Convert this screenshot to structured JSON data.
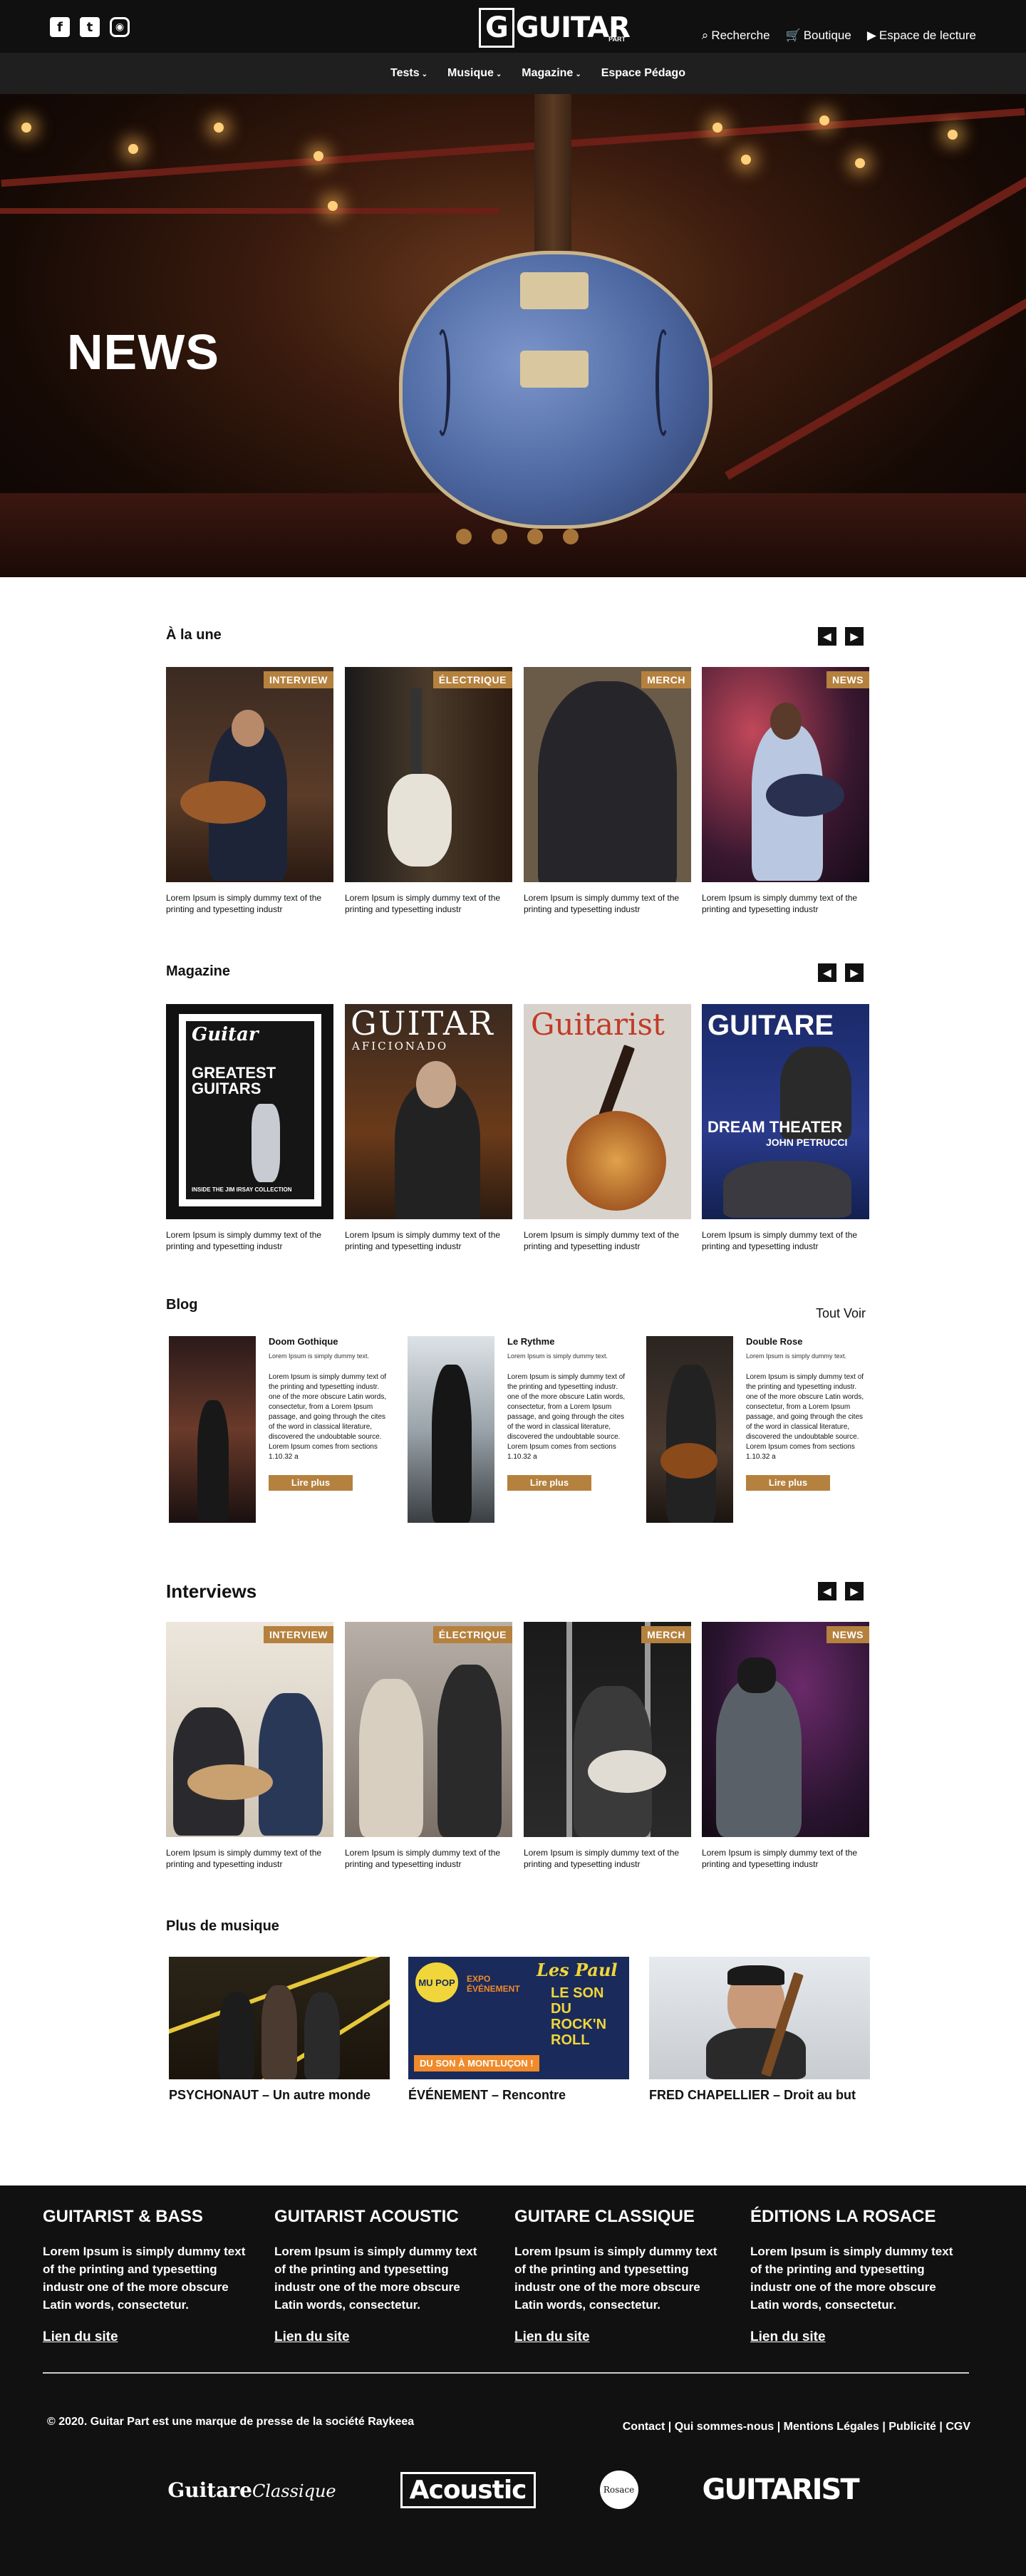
{
  "header": {
    "logo": "GUITAR",
    "logo_sub": "PART",
    "social": [
      "f",
      "t",
      "ig"
    ],
    "tools": {
      "search": "Recherche",
      "shop": "Boutique",
      "reading": "Espace de lecture"
    }
  },
  "nav": [
    "Tests",
    "Musique",
    "Magazine",
    "Espace Pédago"
  ],
  "hero": {
    "title": "NEWS"
  },
  "une": {
    "title": "À la une",
    "cards": [
      {
        "tag": "INTERVIEW",
        "caption": "Lorem Ipsum is simply dummy text of the printing and typesetting industr"
      },
      {
        "tag": "ÉLECTRIQUE",
        "caption": "Lorem Ipsum is simply dummy text of the printing and typesetting industr"
      },
      {
        "tag": "MERCH",
        "caption": "Lorem Ipsum is simply dummy text of the printing and typesetting industr"
      },
      {
        "tag": "NEWS",
        "caption": "Lorem Ipsum is simply dummy text of the printing and typesetting industr"
      }
    ]
  },
  "magazine": {
    "title": "Magazine",
    "covers": [
      {
        "masthead": "Guitar",
        "headline": "GREATEST GUITARS",
        "footer": "INSIDE THE JIM IRSAY COLLECTION",
        "caption": "Lorem Ipsum is simply dummy text of the printing and typesetting industr"
      },
      {
        "masthead": "GUITAR",
        "headline": "AFICIONADO",
        "footer": "",
        "caption": "Lorem Ipsum is simply dummy text of the printing and typesetting industr"
      },
      {
        "masthead": "Guitarist",
        "headline": "",
        "footer": "",
        "caption": "Lorem Ipsum is simply dummy text of the printing and typesetting industr"
      },
      {
        "masthead": "GUITARE",
        "headline": "DREAM THEATER",
        "footer": "JOHN PETRUCCI",
        "caption": "Lorem Ipsum is simply dummy text of the printing and typesetting industr"
      }
    ]
  },
  "blog": {
    "title": "Blog",
    "see_all": "Tout Voir",
    "posts": [
      {
        "title": "Doom Gothique",
        "sub": "Lorem Ipsum is simply dummy text.",
        "body": "Lorem Ipsum is simply dummy text of the printing and typesetting industr. one of the more obscure Latin words, consectetur, from a Lorem Ipsum passage, and going through the cites of the word in classical literature, discovered the undoubtable source. Lorem Ipsum comes from sections 1.10.32 a",
        "button": "Lire plus"
      },
      {
        "title": "Le Rythme",
        "sub": "Lorem Ipsum is simply dummy text.",
        "body": "Lorem Ipsum is simply dummy text of the printing and typesetting industr. one of the more obscure Latin words, consectetur, from a Lorem Ipsum passage, and going through the cites of the word in classical literature, discovered the undoubtable source. Lorem Ipsum comes from sections 1.10.32 a",
        "button": "Lire plus"
      },
      {
        "title": "Double Rose",
        "sub": "Lorem Ipsum is simply dummy text.",
        "body": "Lorem Ipsum is simply dummy text of the printing and typesetting industr. one of the more obscure Latin words, consectetur, from a Lorem Ipsum passage, and going through the cites of the word in classical literature, discovered the undoubtable source. Lorem Ipsum comes from sections 1.10.32 a",
        "button": "Lire plus"
      }
    ]
  },
  "interviews": {
    "title": "Interviews",
    "cards": [
      {
        "tag": "INTERVIEW",
        "caption": "Lorem Ipsum is simply dummy text of the printing and typesetting industr"
      },
      {
        "tag": "ÉLECTRIQUE",
        "caption": "Lorem Ipsum is simply dummy text of the printing and typesetting industr"
      },
      {
        "tag": "MERCH",
        "caption": "Lorem Ipsum is simply dummy text of the printing and typesetting industr"
      },
      {
        "tag": "NEWS",
        "caption": "Lorem Ipsum is simply dummy text of the printing and typesetting industr"
      }
    ]
  },
  "plus": {
    "title": "Plus de musique",
    "items": [
      {
        "title": "PSYCHONAUT – Un autre monde"
      },
      {
        "title": "ÉVÉNEMENT – Rencontre",
        "poster_top": "MU POP",
        "poster_mid": "EXPO ÉVÉNEMENT",
        "poster_side": "Les Paul",
        "poster_big": "LE SON DU ROCK'N ROLL",
        "poster_bottom": "DU SON À MONTLUÇON !"
      },
      {
        "title": "FRED CHAPELLIER – Droit au but"
      }
    ]
  },
  "footer": {
    "cols": [
      {
        "title": "GUITARIST & BASS",
        "body": "Lorem Ipsum is simply dummy text of the printing and typesetting industr one of the more obscure Latin words, consectetur.",
        "link": "Lien du site"
      },
      {
        "title": "GUITARIST ACOUSTIC",
        "body": "Lorem Ipsum is simply dummy text of the printing and typesetting industr one of the more obscure Latin words, consectetur.",
        "link": "Lien du site"
      },
      {
        "title": "GUITARE CLASSIQUE",
        "body": "Lorem Ipsum is simply dummy text of the printing and typesetting industr one of the more obscure Latin words, consectetur.",
        "link": "Lien du site"
      },
      {
        "title": "ÉDITIONS LA ROSACE",
        "body": "Lorem Ipsum is simply dummy text of the printing and typesetting industr one of the more obscure Latin words, consectetur.",
        "link": "Lien du site"
      }
    ],
    "copyright": "© 2020. Guitar Part est une marque de presse de la société Raykeea",
    "links": [
      "Contact",
      "Qui sommes-nous",
      "Mentions Légales",
      "Publicité",
      "CGV"
    ],
    "brands": {
      "b1": "Guitare",
      "b1i": "Classique",
      "b2": "Acoustic",
      "b3": "Rosace",
      "b4": "GUITARIST"
    }
  },
  "colors": {
    "accent": "#b5813e",
    "header_bg": "#101010",
    "nav_bg": "#1f1f1f",
    "footer_bg": "#111111"
  }
}
